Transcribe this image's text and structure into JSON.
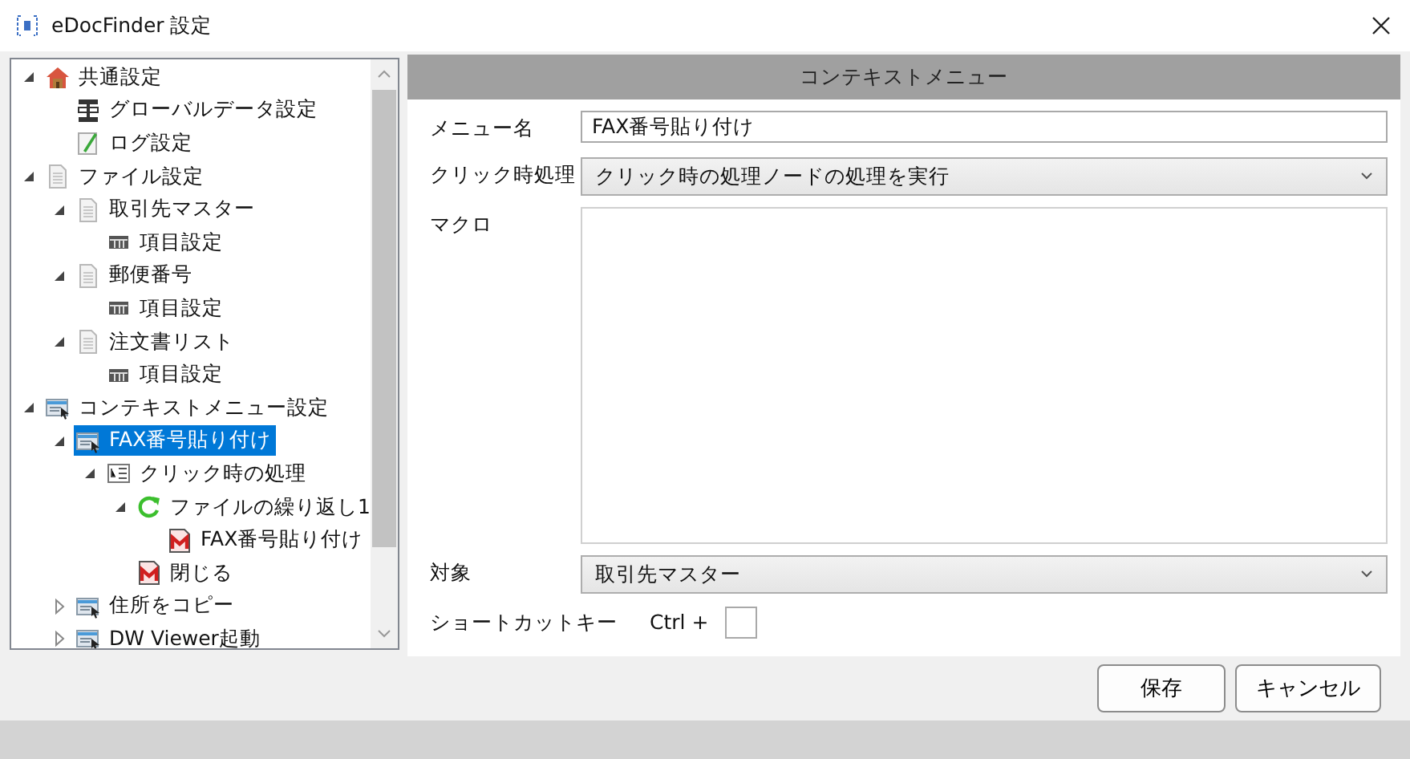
{
  "window": {
    "title": "eDocFinder 設定"
  },
  "tree": [
    {
      "label": "共通設定",
      "kind": "house",
      "expanded": true,
      "selected": false,
      "children": [
        {
          "label": "グローバルデータ設定",
          "kind": "data",
          "selected": false
        },
        {
          "label": "ログ設定",
          "kind": "log",
          "selected": false
        }
      ]
    },
    {
      "label": "ファイル設定",
      "kind": "file",
      "expanded": true,
      "selected": false,
      "children": [
        {
          "label": "取引先マスター",
          "kind": "file",
          "expanded": true,
          "selected": false,
          "children": [
            {
              "label": "項目設定",
              "kind": "table",
              "selected": false
            }
          ]
        },
        {
          "label": "郵便番号",
          "kind": "file",
          "expanded": true,
          "selected": false,
          "children": [
            {
              "label": "項目設定",
              "kind": "table",
              "selected": false
            }
          ]
        },
        {
          "label": "注文書リスト",
          "kind": "file",
          "expanded": true,
          "selected": false,
          "children": [
            {
              "label": "項目設定",
              "kind": "table",
              "selected": false
            }
          ]
        }
      ]
    },
    {
      "label": "コンテキストメニュー設定",
      "kind": "menu",
      "expanded": true,
      "selected": false,
      "children": [
        {
          "label": "FAX番号貼り付け",
          "kind": "menu",
          "expanded": true,
          "selected": true,
          "children": [
            {
              "label": "クリック時の処理",
              "kind": "process",
              "expanded": true,
              "selected": false,
              "children": [
                {
                  "label": "ファイルの繰り返し1",
                  "kind": "loop",
                  "expanded": true,
                  "selected": false,
                  "children": [
                    {
                      "label": "FAX番号貼り付け",
                      "kind": "macro",
                      "selected": false
                    }
                  ]
                },
                {
                  "label": "閉じる",
                  "kind": "macro",
                  "selected": false
                }
              ]
            }
          ]
        },
        {
          "label": "住所をコピー",
          "kind": "menu",
          "expanded": false,
          "selected": false
        },
        {
          "label": "DW Viewer起動",
          "kind": "menu",
          "expanded": false,
          "selected": false
        }
      ]
    }
  ],
  "panel": {
    "title": "コンテキストメニュー",
    "fields": [
      {
        "kind": "text",
        "label": "メニュー名",
        "value": "FAX番号貼り付け"
      },
      {
        "kind": "select",
        "label": "クリック時処理",
        "value": "クリック時の処理ノードの処理を実行"
      },
      {
        "kind": "textarea",
        "label": "マクロ"
      },
      {
        "kind": "select",
        "label": "対象",
        "value": "取引先マスター"
      },
      {
        "kind": "shortcut",
        "label": "ショートカットキー",
        "prefix": "Ctrl +"
      }
    ]
  },
  "buttons": [
    "保存",
    "キャンセル"
  ]
}
